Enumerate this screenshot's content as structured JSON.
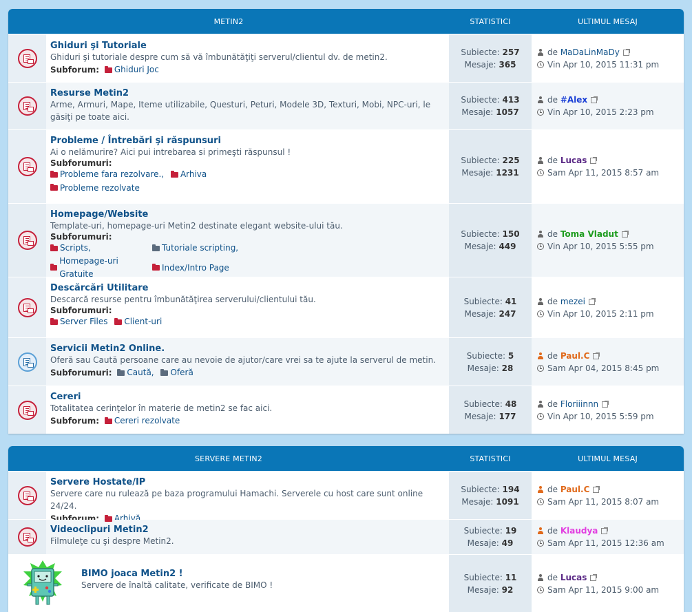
{
  "categories": [
    {
      "header": {
        "name": "METIN2",
        "stats": "STATISTICI",
        "last": "ULTIMUL MESAJ"
      },
      "forums": [
        {
          "title": "Ghiduri şi Tutoriale",
          "desc": "Ghiduri şi tutoriale despre cum să vă îmbunătăţiţi serverul/clientul dv. de metin2.",
          "sub_label": "Subforum:",
          "subs": [
            "Ghiduri Joc"
          ],
          "topics_label": "Subiecte:",
          "topics": "257",
          "posts_label": "Mesaje:",
          "posts": "365",
          "by": "de",
          "author": "MaDaLinMaDy",
          "author_color": "#105289",
          "date": "Vin Apr 10, 2015 11:31 pm"
        },
        {
          "title": "Resurse Metin2",
          "desc": "Arme, Armuri, Mape, Iteme utilizabile, Questuri, Peturi, Modele 3D, Texturi, Mobi, NPC-uri, le găsiţi pe toate aici.",
          "sub_label": "",
          "subs": [],
          "topics_label": "Subiecte:",
          "topics": "413",
          "posts_label": "Mesaje:",
          "posts": "1057",
          "by": "de",
          "author": "#Alex",
          "author_color": "#1a3fd6",
          "date": "Vin Apr 10, 2015 2:23 pm"
        },
        {
          "title": "Probleme / Întrebări şi răspunsuri",
          "desc": "Ai o nelămurire? Aici pui intrebarea si primeşti răspunsul !",
          "sub_label": "Subforumuri:",
          "subs": [
            "Probleme fara rezolvare.,",
            "Arhiva",
            "Probleme rezolvate"
          ],
          "topics_label": "Subiecte:",
          "topics": "225",
          "posts_label": "Mesaje:",
          "posts": "1231",
          "by": "de",
          "author": "Lucas",
          "author_color": "#5b2a86",
          "date": "Sam Apr 11, 2015 8:57 am"
        },
        {
          "title": "Homepage/Website",
          "desc": "Template-uri, homepage-uri Metin2 destinate elegant website-ului tău.",
          "sub_label": "Subforumuri:",
          "subs": [
            "Scripts,",
            "Tutoriale scripting,",
            "Homepage-uri Gratuite",
            "Index/Intro Page"
          ],
          "topics_label": "Subiecte:",
          "topics": "150",
          "posts_label": "Mesaje:",
          "posts": "449",
          "by": "de",
          "author": "Toma Vladut",
          "author_color": "#1e9c1e",
          "date": "Vin Apr 10, 2015 5:55 pm"
        },
        {
          "title": "Descărcări Utilitare",
          "desc": "Descarcă resurse pentru îmbunătăţirea serverului/clientului tău.",
          "sub_label": "Subforumuri:",
          "subs": [
            "Server Files",
            "Client-uri"
          ],
          "topics_label": "Subiecte:",
          "topics": "41",
          "posts_label": "Mesaje:",
          "posts": "247",
          "by": "de",
          "author": "mezei",
          "author_color": "#105289",
          "date": "Vin Apr 10, 2015 2:11 pm"
        },
        {
          "title": "Servicii Metin2 Online.",
          "desc": "Oferă sau Caută persoane care au nevoie de ajutor/care vrei sa te ajute la serverul de metin.",
          "sub_label": "Subforumuri:",
          "subs": [
            "Caută,",
            "Oferă"
          ],
          "topics_label": "Subiecte:",
          "topics": "5",
          "posts_label": "Mesaje:",
          "posts": "28",
          "by": "de",
          "author": "Paul.C",
          "author_color": "#e06a1c",
          "date": "Sam Apr 04, 2015 8:45 pm"
        },
        {
          "title": "Cereri",
          "desc": "Totalitatea cerinţelor în materie de metin2 se fac aici.",
          "sub_label": "Subforum:",
          "subs": [
            "Cereri rezolvate"
          ],
          "topics_label": "Subiecte:",
          "topics": "48",
          "posts_label": "Mesaje:",
          "posts": "177",
          "by": "de",
          "author": "Floriiinnn",
          "author_color": "#105289",
          "date": "Vin Apr 10, 2015 5:59 pm"
        }
      ]
    },
    {
      "header": {
        "name": "SERVERE METIN2",
        "stats": "STATISTICI",
        "last": "ULTIMUL MESAJ"
      },
      "forums": [
        {
          "title": "Servere Hostate/IP",
          "desc": "Servere care nu rulează pe baza programului Hamachi. Serverele cu host care sunt online 24/24.",
          "sub_label": "Subforum:",
          "subs": [
            "Arhivă"
          ],
          "topics_label": "Subiecte:",
          "topics": "194",
          "posts_label": "Mesaje:",
          "posts": "1091",
          "by": "de",
          "author": "Paul.C",
          "author_color": "#e06a1c",
          "date": "Sam Apr 11, 2015 8:07 am"
        },
        {
          "title": "Videoclipuri Metin2",
          "desc": "Filmuleţe cu şi despre Metin2.",
          "sub_label": "",
          "subs": [],
          "topics_label": "Subiecte:",
          "topics": "19",
          "posts_label": "Mesaje:",
          "posts": "49",
          "by": "de",
          "author": "Klaudya",
          "author_color": "#e23ee0",
          "date": "Sam Apr 11, 2015 12:36 am"
        },
        {
          "title": "BIMO joaca Metin2 !",
          "desc": "Servere de înaltă calitate, verificate de BIMO !",
          "sub_label": "",
          "subs": [],
          "topics_label": "Subiecte:",
          "topics": "11",
          "posts_label": "Mesaje:",
          "posts": "92",
          "by": "de",
          "author": "Lucas",
          "author_color": "#5b2a86",
          "date": "Sam Apr 11, 2015 9:00 am"
        }
      ]
    }
  ]
}
